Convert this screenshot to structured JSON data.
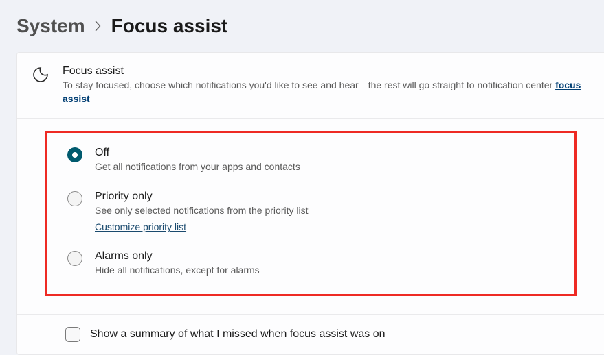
{
  "breadcrumb": {
    "parent": "System",
    "current": "Focus assist"
  },
  "header": {
    "title": "Focus assist",
    "description_before": "To stay focused, choose which notifications you'd like to see and hear—the rest will go straight to notification center ",
    "link_text": "focus assist"
  },
  "options": [
    {
      "title": "Off",
      "desc": "Get all notifications from your apps and contacts",
      "selected": true
    },
    {
      "title": "Priority only",
      "desc": "See only selected notifications from the priority list",
      "selected": false,
      "customize_link": "Customize priority list"
    },
    {
      "title": "Alarms only",
      "desc": "Hide all notifications, except for alarms",
      "selected": false
    }
  ],
  "summary": {
    "label": "Show a summary of what I missed when focus assist was on",
    "checked": false
  }
}
